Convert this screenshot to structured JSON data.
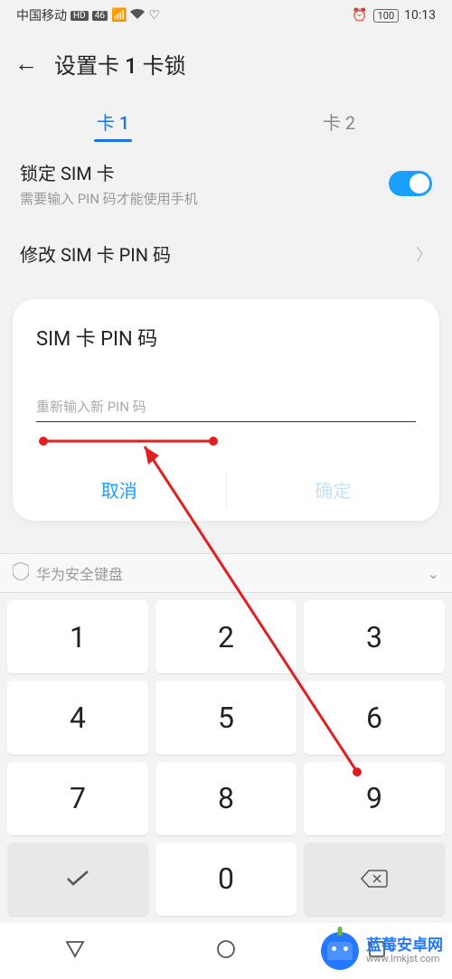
{
  "status": {
    "carrier": "中国移动",
    "badge_hd": "HD",
    "badge_net": "46",
    "time": "10:13",
    "battery": "100"
  },
  "header": {
    "title": "设置卡 1 卡锁"
  },
  "tabs": {
    "tab1": "卡 1",
    "tab2": "卡 2"
  },
  "sim_lock": {
    "label": "锁定 SIM 卡",
    "sub": "需要输入 PIN 码才能使用手机"
  },
  "change_pin": {
    "label": "修改 SIM 卡 PIN 码"
  },
  "dialog": {
    "title": "SIM 卡 PIN 码",
    "placeholder": "重新输入新 PIN 码",
    "cancel": "取消",
    "confirm": "确定"
  },
  "keyboard": {
    "brand": "华为安全键盘",
    "keys": [
      "1",
      "2",
      "3",
      "4",
      "5",
      "6",
      "7",
      "8",
      "9",
      "",
      "0",
      ""
    ]
  },
  "watermark": {
    "title": "蓝莓安卓网",
    "url": "www.lmkjst.com"
  }
}
